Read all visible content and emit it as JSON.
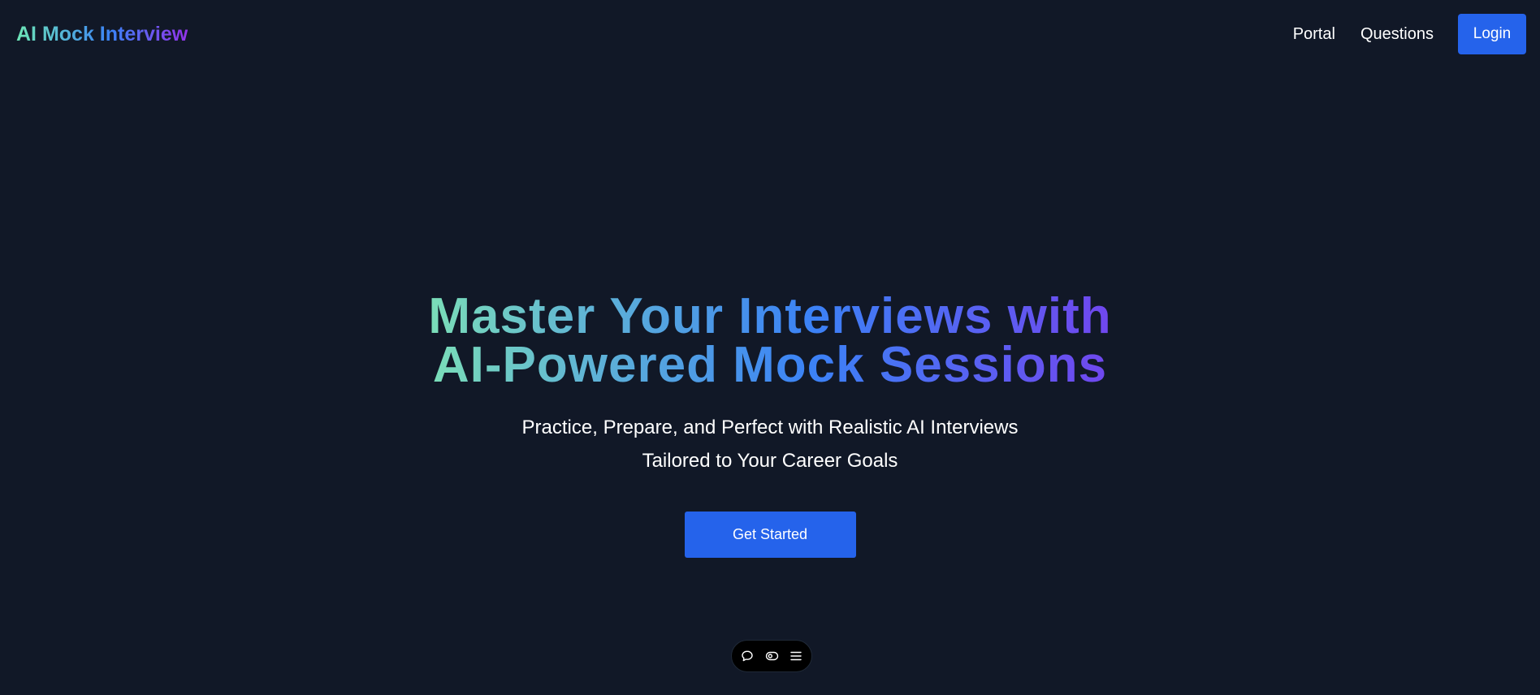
{
  "brand": {
    "name": "AI Mock Interview"
  },
  "nav": {
    "links": [
      {
        "label": "Portal"
      },
      {
        "label": "Questions"
      }
    ],
    "login_label": "Login"
  },
  "hero": {
    "title_line1": "Master Your Interviews with",
    "title_line2": "AI-Powered Mock Sessions",
    "subtitle_line1": "Practice, Prepare, and Perfect with Realistic AI Interviews",
    "subtitle_line2": "Tailored to Your Career Goals",
    "cta_label": "Get Started"
  },
  "toolbar": {
    "icons": [
      "chat-bubble-icon",
      "toggle-icon",
      "menu-icon"
    ]
  },
  "colors": {
    "background": "#111827",
    "accent": "#2563eb",
    "gradient_start": "#86efac",
    "gradient_mid": "#3b82f6",
    "gradient_end": "#7c3aed"
  }
}
